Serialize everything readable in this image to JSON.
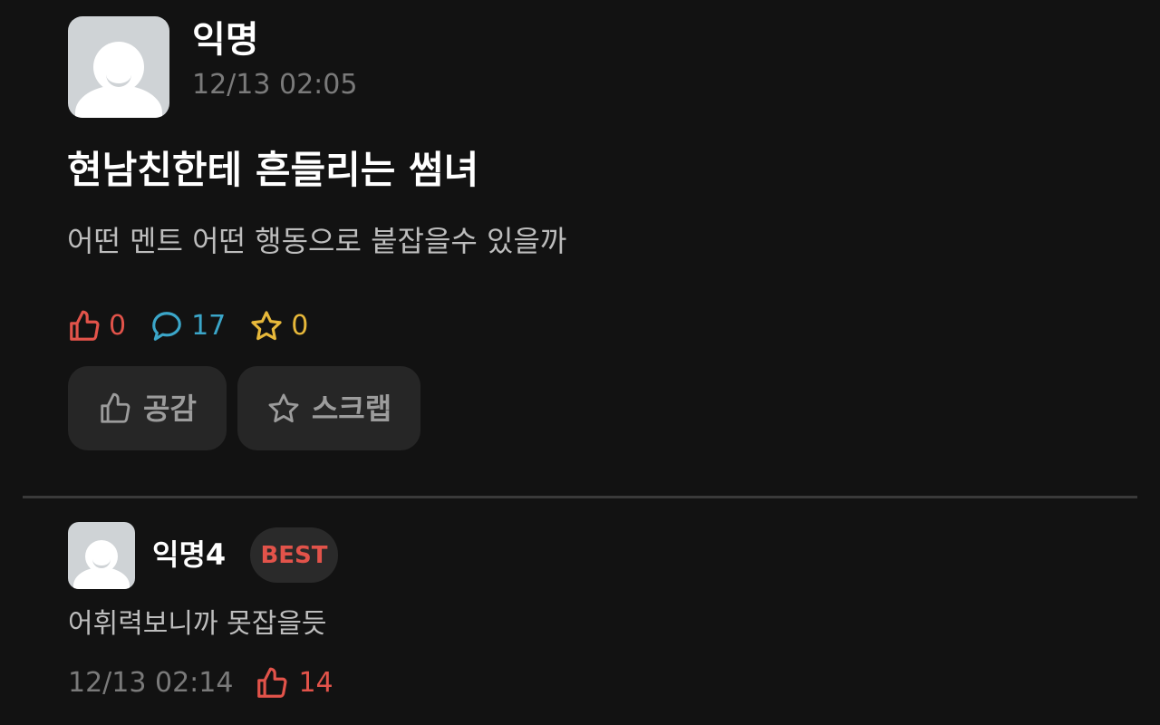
{
  "post": {
    "author": "익명",
    "time": "12/13 02:05",
    "title": "현남친한테 흔들리는 썸녀",
    "body": "어떤 멘트 어떤 행동으로 붙잡을수 있을까",
    "stats": {
      "likes": "0",
      "comments": "17",
      "scraps": "0"
    },
    "actions": {
      "like_label": "공감",
      "scrap_label": "스크랩"
    }
  },
  "comment": {
    "author": "익명4",
    "badge": "BEST",
    "body": "어휘력보니까 못잡을듯",
    "time": "12/13 02:14",
    "likes": "14"
  },
  "colors": {
    "background": "#121212",
    "like_accent": "#e2534a",
    "comment_accent": "#3ba6c9",
    "scrap_accent": "#e7b83a",
    "button_bg": "#262626"
  },
  "icons": [
    "thumbs-up-icon",
    "speech-bubble-icon",
    "star-icon"
  ]
}
